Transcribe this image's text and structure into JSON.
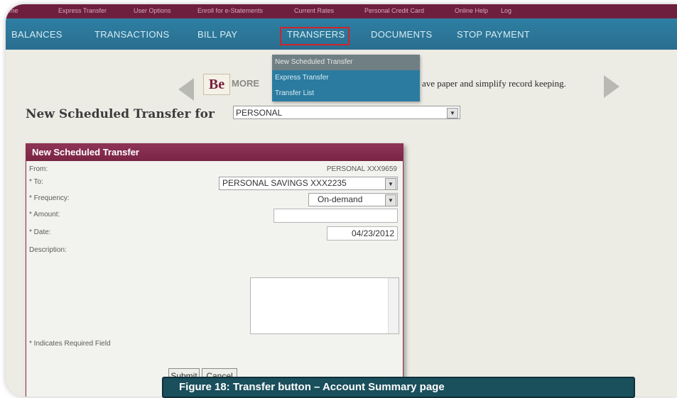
{
  "utility_nav": [
    "ome",
    "Express Transfer",
    "User Options",
    "Enroll for e-Statements",
    "Current Rates",
    "Personal Credit Card",
    "Online Help",
    "Log"
  ],
  "main_nav": {
    "tabs": [
      "BALANCES",
      "TRANSACTIONS",
      "BILL PAY",
      "TRANSFERS",
      "DOCUMENTS",
      "STOP PAYMENT"
    ],
    "active": "TRANSFERS"
  },
  "transfers_menu": [
    "New Scheduled Transfer",
    "Express Transfer",
    "Transfer List"
  ],
  "banner": {
    "logo": "Be",
    "more": "MORE",
    "tail": "ave paper and simplify record keeping."
  },
  "page_title": "New Scheduled Transfer for",
  "account_select": "PERSONAL",
  "form": {
    "title": "New Scheduled Transfer",
    "from_label": "From:",
    "from_value": "PERSONAL XXX9659",
    "to_label": "* To:",
    "to_value": "PERSONAL SAVINGS XXX2235",
    "frequency_label": "* Frequency:",
    "frequency_value": "On-demand",
    "amount_label": "* Amount:",
    "amount_value": "",
    "date_label": "* Date:",
    "date_value": "04/23/2012",
    "description_label": "Description:",
    "required_note": "* Indicates Required Field",
    "submit": "Submit",
    "cancel": "Cancel"
  },
  "caption": "Figure 18: Transfer button – Account Summary page",
  "colors": {
    "util_bar": "#6e1f3e",
    "nav": "#2d7fa3",
    "panel_header": "#8e3456",
    "highlight": "#d2232a",
    "caption": "#1a4f5c"
  }
}
